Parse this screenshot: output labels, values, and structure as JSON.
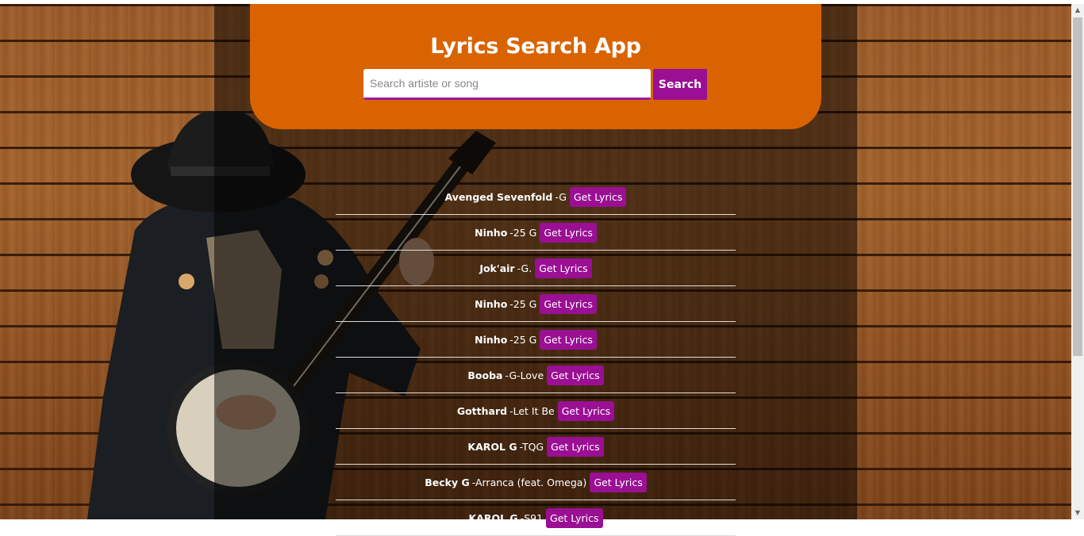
{
  "header": {
    "title": "Lyrics Search App",
    "search_placeholder": "Search artiste or song",
    "search_value": "",
    "search_button": "Search"
  },
  "results": [
    {
      "artist": "Avenged Sevenfold",
      "song": "-G",
      "button": "Get Lyrics"
    },
    {
      "artist": "Ninho",
      "song": "-25 G",
      "button": "Get Lyrics"
    },
    {
      "artist": "Jok'air",
      "song": "-G.",
      "button": "Get Lyrics"
    },
    {
      "artist": "Ninho",
      "song": "-25 G",
      "button": "Get Lyrics"
    },
    {
      "artist": "Ninho",
      "song": "-25 G",
      "button": "Get Lyrics"
    },
    {
      "artist": "Booba",
      "song": "-G-Love",
      "button": "Get Lyrics"
    },
    {
      "artist": "Gotthard",
      "song": "-Let It Be",
      "button": "Get Lyrics"
    },
    {
      "artist": "KAROL G",
      "song": "-TQG",
      "button": "Get Lyrics"
    },
    {
      "artist": "Becky G",
      "song": "-Arranca (feat. Omega)",
      "button": "Get Lyrics"
    },
    {
      "artist": "KAROL G",
      "song": "-S91",
      "button": "Get Lyrics"
    }
  ],
  "colors": {
    "header_bg": "#d96300",
    "accent": "#9a0f93"
  }
}
